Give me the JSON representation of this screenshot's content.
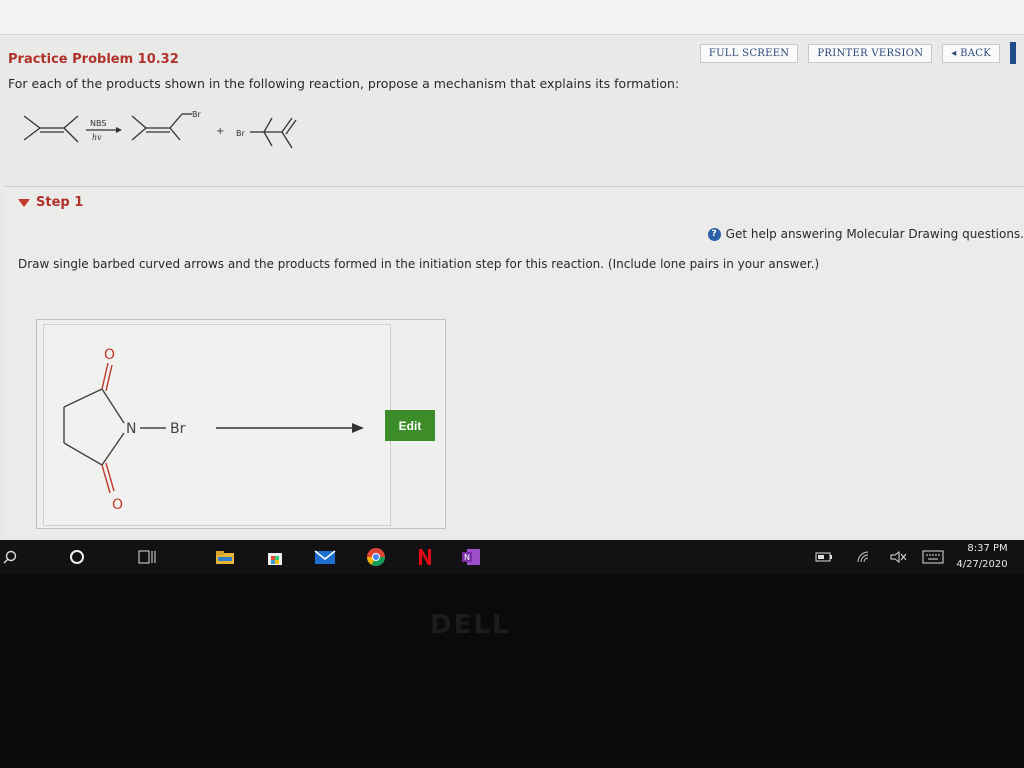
{
  "header": {
    "full_screen": "FULL SCREEN",
    "printer_version": "PRINTER VERSION",
    "back": "◂ BACK"
  },
  "problem": {
    "title": "Practice Problem 10.32",
    "instruction": "For each of the products shown in the following reaction, propose a mechanism that explains its formation:"
  },
  "reaction": {
    "reagent_top": "NBS",
    "reagent_bottom": "hv",
    "br_product1": "Br",
    "plus": "+",
    "br_product2": "Br"
  },
  "step": {
    "label": "Step 1",
    "help_text": "Get help answering Molecular Drawing questions.",
    "instruction": "Draw single barbed curved arrows and the products formed in the initiation step for this reaction. (Include lone pairs in your answer.)",
    "edit_label": "Edit"
  },
  "molecule": {
    "o_top": "O",
    "o_bottom": "O",
    "n": "N",
    "br": "Br"
  },
  "taskbar": {
    "time": "8:37 PM",
    "date": "4/27/2020"
  },
  "bezel": {
    "brand": "DELL"
  },
  "colors": {
    "title_red": "#b0322a",
    "edit_green": "#3c8c2a",
    "help_blue": "#2b5fa8"
  }
}
